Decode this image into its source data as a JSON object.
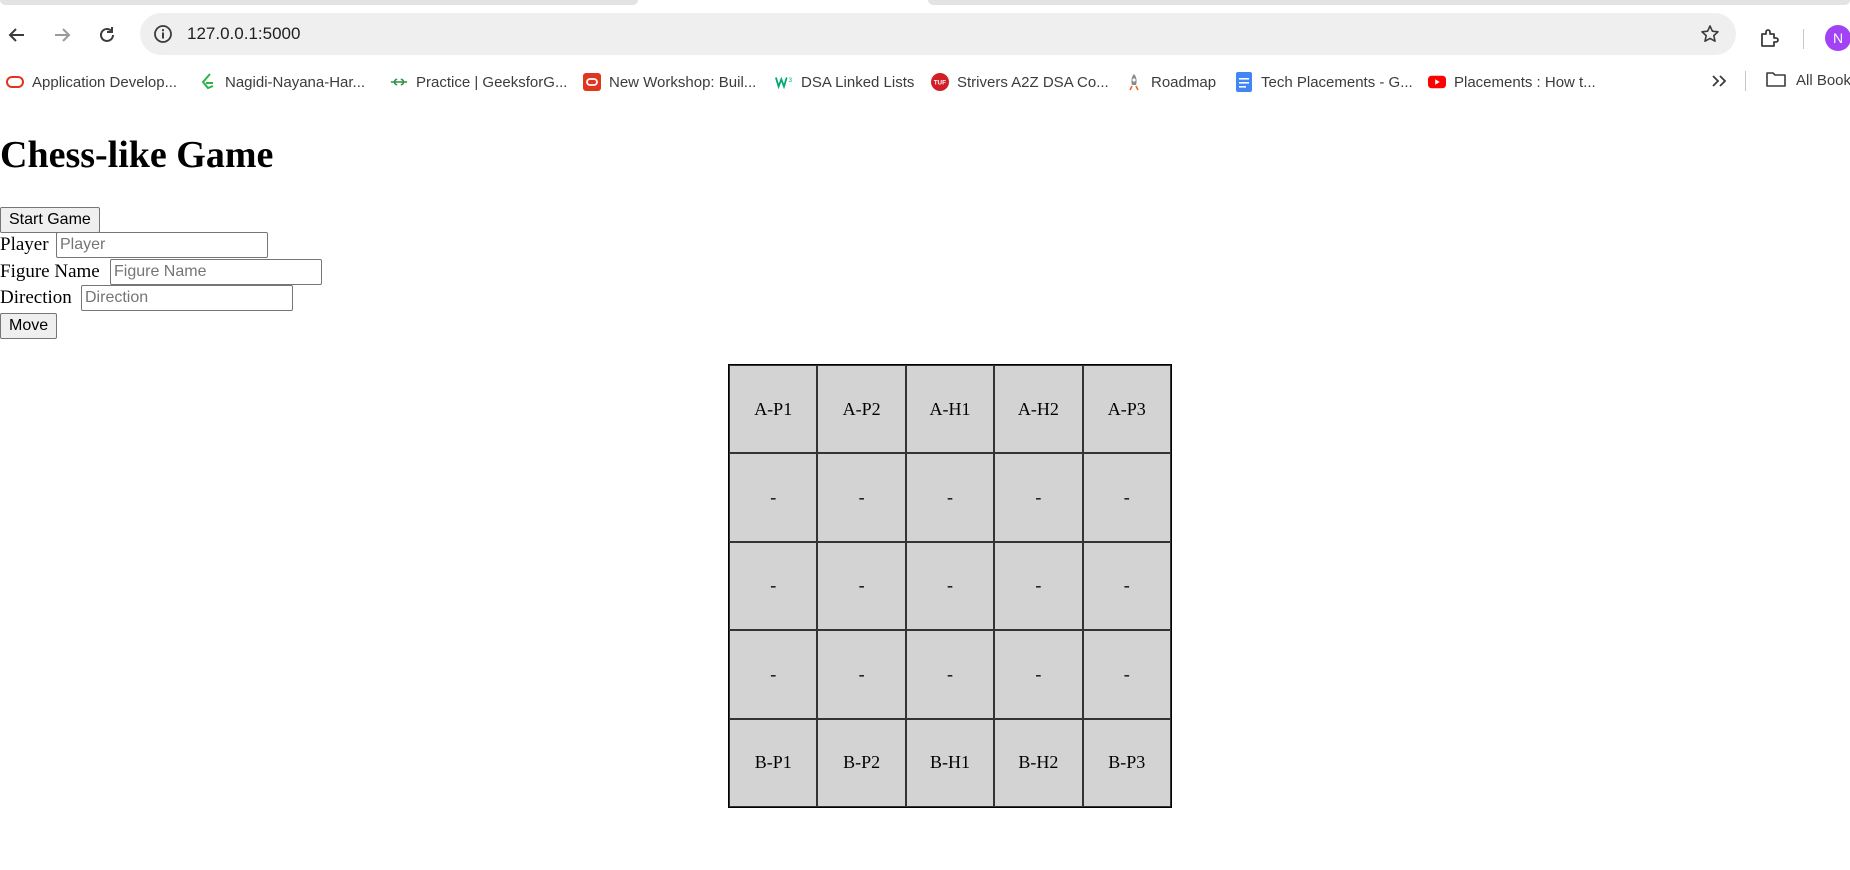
{
  "browser": {
    "url": "127.0.0.1:5000",
    "profile_initial": "N",
    "bookmarks": [
      {
        "label": "Application Develop...",
        "icon": "oracle-icon"
      },
      {
        "label": "Nagidi-Nayana-Har...",
        "icon": "leetcode-icon"
      },
      {
        "label": "Practice | GeeksforG...",
        "icon": "geeksforgeeks-icon"
      },
      {
        "label": "New Workshop: Buil...",
        "icon": "oracle-icon"
      },
      {
        "label": "DSA Linked Lists",
        "icon": "w3-icon"
      },
      {
        "label": "Strivers A2Z DSA Co...",
        "icon": "tuf-icon"
      },
      {
        "label": "Roadmap",
        "icon": "rocket-icon"
      },
      {
        "label": "Tech Placements - G...",
        "icon": "google-docs-icon"
      },
      {
        "label": "Placements : How t...",
        "icon": "youtube-icon"
      }
    ],
    "all_bookmarks_label": "All Bookmarks"
  },
  "page": {
    "title": "Chess-like Game",
    "start_button": "Start Game",
    "player_label": "Player",
    "player_placeholder": "Player",
    "figure_label": "Figure Name",
    "figure_placeholder": "Figure Name",
    "direction_label": "Direction",
    "direction_placeholder": "Direction",
    "move_button": "Move"
  },
  "board": {
    "rows": [
      [
        "A-P1",
        "A-P2",
        "A-H1",
        "A-H2",
        "A-P3"
      ],
      [
        "-",
        "-",
        "-",
        "-",
        "-"
      ],
      [
        "-",
        "-",
        "-",
        "-",
        "-"
      ],
      [
        "-",
        "-",
        "-",
        "-",
        "-"
      ],
      [
        "B-P1",
        "B-P2",
        "B-H1",
        "B-H2",
        "B-P3"
      ]
    ]
  },
  "colors": {
    "cell_background": "#d3d3d3",
    "avatar": "#a142f4"
  }
}
